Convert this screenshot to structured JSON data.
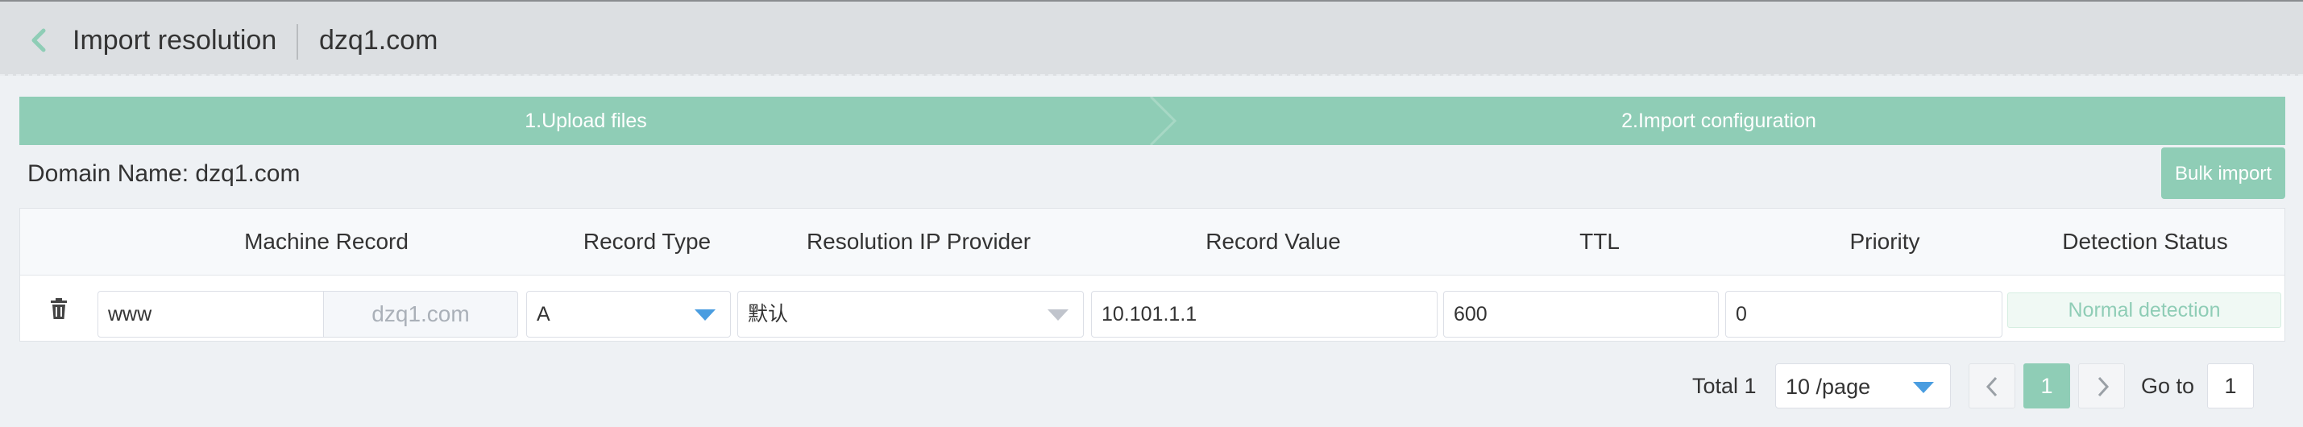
{
  "header": {
    "title": "Import resolution",
    "domain": "dzq1.com"
  },
  "steps": [
    {
      "label": "1.Upload files"
    },
    {
      "label": "2.Import configuration"
    }
  ],
  "domain_name": "Domain Name: dzq1.com",
  "bulk_import_label": "Bulk import",
  "table": {
    "columns": [
      "Machine Record",
      "Record Type",
      "Resolution IP Provider",
      "Record Value",
      "TTL",
      "Priority",
      "Detection Status"
    ],
    "rows": [
      {
        "machine_record": "www",
        "suffix": "dzq1.com",
        "record_type": "A",
        "provider": "默认",
        "record_value": "10.101.1.1",
        "ttl": "600",
        "priority": "0",
        "status": "Normal detection"
      }
    ]
  },
  "pagination": {
    "total": "Total 1",
    "page_size": "10 /page",
    "current_page": "1",
    "goto_label": "Go to",
    "goto_value": "1"
  },
  "colors": {
    "accent": "#8fcdb6",
    "dropdown_caret": "#4a9de0"
  }
}
